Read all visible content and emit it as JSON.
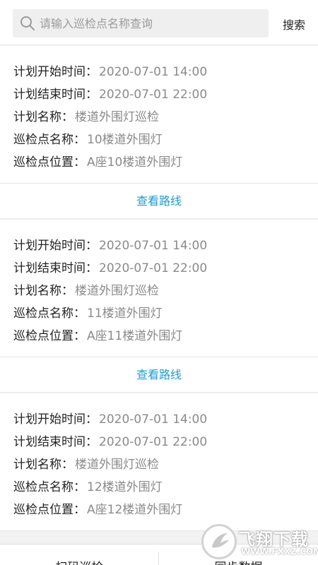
{
  "search": {
    "placeholder": "请输入巡检点名称查询",
    "button_label": "搜索"
  },
  "records": [
    {
      "rows": [
        {
          "label": "计划开始时间：",
          "value": "2020-07-01 14:00"
        },
        {
          "label": "计划结束时间：",
          "value": "2020-07-01 22:00"
        },
        {
          "label": "计划名称：",
          "value": "楼道外围灯巡检"
        },
        {
          "label": "巡检点名称：",
          "value": "10楼道外围灯"
        },
        {
          "label": "巡检点位置：",
          "value": "A座10楼道外围灯"
        }
      ],
      "link_label": "查看路线"
    },
    {
      "rows": [
        {
          "label": "计划开始时间：",
          "value": "2020-07-01 14:00"
        },
        {
          "label": "计划结束时间：",
          "value": "2020-07-01 22:00"
        },
        {
          "label": "计划名称：",
          "value": "楼道外围灯巡检"
        },
        {
          "label": "巡检点名称：",
          "value": "11楼道外围灯"
        },
        {
          "label": "巡检点位置：",
          "value": "A座11楼道外围灯"
        }
      ],
      "link_label": "查看路线"
    },
    {
      "rows": [
        {
          "label": "计划开始时间：",
          "value": "2020-07-01 14:00"
        },
        {
          "label": "计划结束时间：",
          "value": "2020-07-01 22:00"
        },
        {
          "label": "计划名称：",
          "value": "楼道外围灯巡检"
        },
        {
          "label": "巡检点名称：",
          "value": "12楼道外围灯"
        },
        {
          "label": "巡检点位置：",
          "value": "A座12楼道外围灯"
        }
      ],
      "link_label": ""
    }
  ],
  "bottom_bar": {
    "left_label": "扫码巡检",
    "right_label": "同步数据"
  },
  "watermark": {
    "title": "飞翔下载",
    "url": "WWW.FXXZ.COM"
  },
  "colors": {
    "link": "#1e9cd4",
    "background": "#f2f2f2",
    "value_text": "#8a8a8a"
  }
}
